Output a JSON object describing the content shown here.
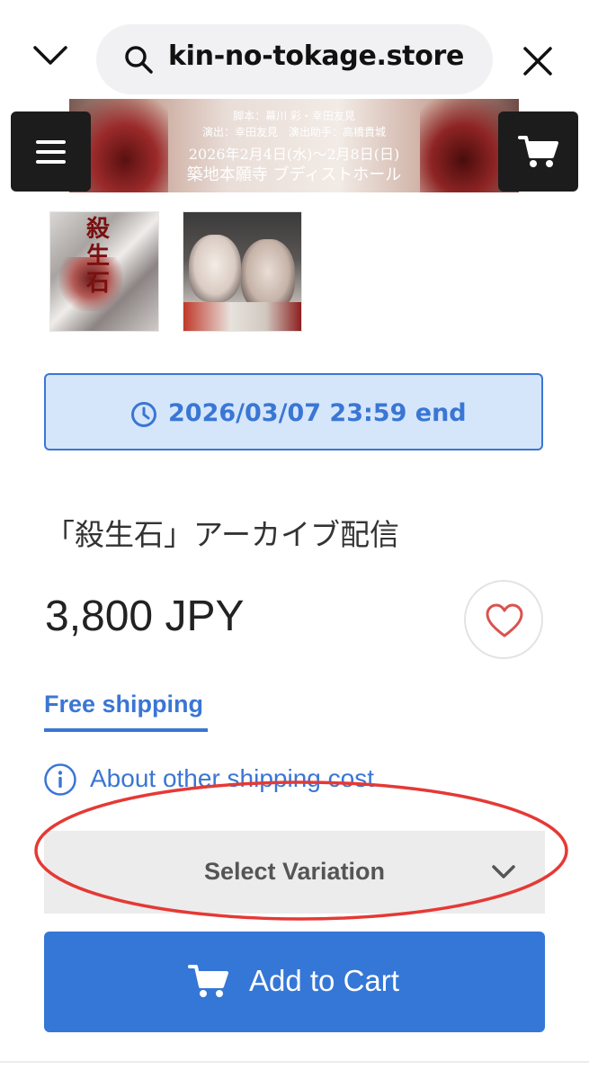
{
  "browser": {
    "url": "kin-no-tokage.store",
    "icons": [
      "chevron-down-icon",
      "search-icon",
      "close-icon"
    ]
  },
  "banner": {
    "line1": "脚本：幕川 彩・幸田友見",
    "line2": "演出：幸田友見　演出助手：高橋貴城",
    "line3": "2026年2月4日(水)〜2月8日(日)",
    "line4": "築地本願寺 ブディストホール"
  },
  "thumbnails": {
    "first_kanji": "殺生石"
  },
  "header_buttons": {
    "menu_icon": "hamburger-menu-icon",
    "cart_icon": "cart-icon"
  },
  "sale_end": {
    "text": "2026/03/07 23:59 end"
  },
  "product": {
    "title": "「殺生石」アーカイブ配信",
    "price": "3,800 JPY",
    "free_shipping": "Free shipping",
    "other_shipping": "About other shipping cost"
  },
  "variation": {
    "placeholder": "Select Variation"
  },
  "cart": {
    "add_label": "Add to Cart"
  },
  "colors": {
    "accent": "#3577d6",
    "highlight": "#e53935",
    "end_box_bg": "#d5e6fb"
  }
}
